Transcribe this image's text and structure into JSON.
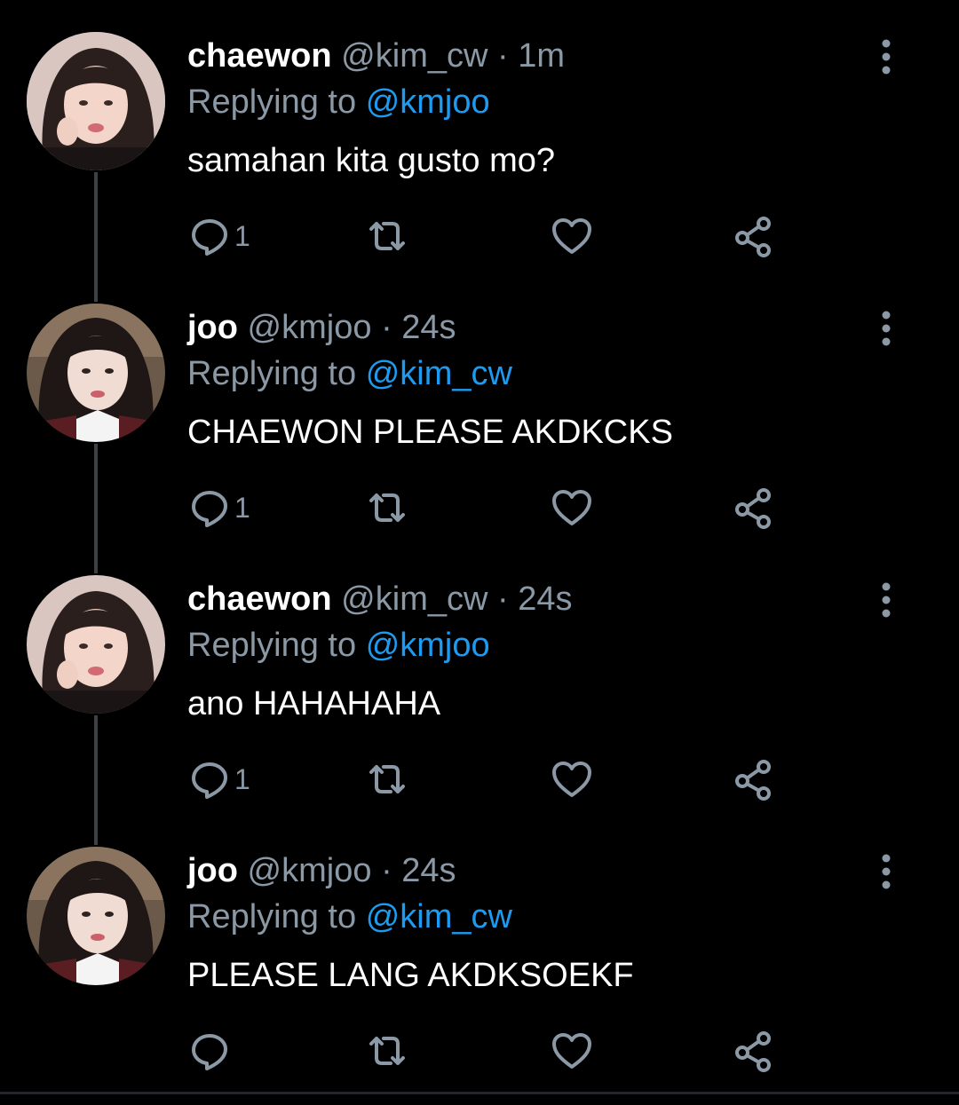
{
  "colors": {
    "background": "#000000",
    "name": "#ffffff",
    "secondary": "#8b98a5",
    "mention": "#1d9bf0",
    "thread_line": "#3d4145"
  },
  "tweets": [
    {
      "name": "chaewon",
      "handle": "@kim_cw",
      "separator": "·",
      "time": "1m",
      "reply_prefix": "Replying to",
      "reply_to": "@kmjoo",
      "text": "samahan kita gusto mo?",
      "reply_count": "1",
      "avatar": "avatar-chaewon"
    },
    {
      "name": "joo",
      "handle": "@kmjoo",
      "separator": "·",
      "time": "24s",
      "reply_prefix": "Replying to",
      "reply_to": "@kim_cw",
      "text": "CHAEWON PLEASE AKDKCKS",
      "reply_count": "1",
      "avatar": "avatar-joo"
    },
    {
      "name": "chaewon",
      "handle": "@kim_cw",
      "separator": "·",
      "time": "24s",
      "reply_prefix": "Replying to",
      "reply_to": "@kmjoo",
      "text": "ano HAHAHAHA",
      "reply_count": "1",
      "avatar": "avatar-chaewon"
    },
    {
      "name": "joo",
      "handle": "@kmjoo",
      "separator": "·",
      "time": "24s",
      "reply_prefix": "Replying to",
      "reply_to": "@kim_cw",
      "text": "PLEASE LANG AKDKSOEKF",
      "reply_count": "",
      "avatar": "avatar-joo"
    }
  ],
  "icons": {
    "reply": "reply-icon",
    "retweet": "retweet-icon",
    "like": "heart-icon",
    "share": "share-icon",
    "more": "more-vertical-icon"
  }
}
